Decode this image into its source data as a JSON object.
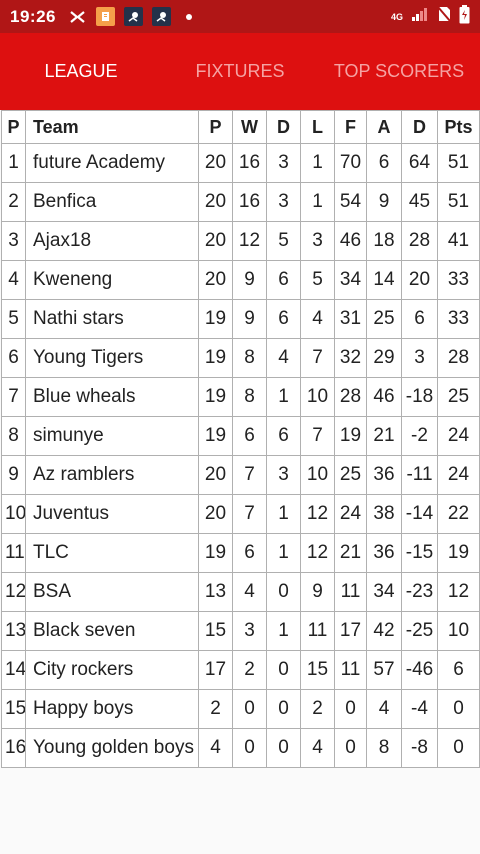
{
  "status_bar": {
    "time": "19:26",
    "network_label": "4G",
    "icons": [
      "capcut-icon",
      "app-icon",
      "football-app-icon",
      "football-app-icon",
      "notification-dot",
      "signal-icon",
      "no-sim-icon",
      "battery-icon"
    ]
  },
  "tabs": [
    {
      "label": "LEAGUE",
      "active": true
    },
    {
      "label": "FIXTURES",
      "active": false
    },
    {
      "label": "TOP SCORERS",
      "active": false
    }
  ],
  "colors": {
    "status_bar": "#b01616",
    "app_bar": "#dd1010",
    "tab_active": "#ffffff",
    "tab_inactive": "#f5a3a3"
  },
  "table": {
    "headers": [
      "P",
      "Team",
      "P",
      "W",
      "D",
      "L",
      "F",
      "A",
      "D",
      "Pts"
    ],
    "rows": [
      [
        "1",
        "future Academy",
        "20",
        "16",
        "3",
        "1",
        "70",
        "6",
        "64",
        "51"
      ],
      [
        "2",
        "Benfica",
        "20",
        "16",
        "3",
        "1",
        "54",
        "9",
        "45",
        "51"
      ],
      [
        "3",
        "Ajax18",
        "20",
        "12",
        "5",
        "3",
        "46",
        "18",
        "28",
        "41"
      ],
      [
        "4",
        "Kweneng",
        "20",
        "9",
        "6",
        "5",
        "34",
        "14",
        "20",
        "33"
      ],
      [
        "5",
        "Nathi stars",
        "19",
        "9",
        "6",
        "4",
        "31",
        "25",
        "6",
        "33"
      ],
      [
        "6",
        "Young Tigers",
        "19",
        "8",
        "4",
        "7",
        "32",
        "29",
        "3",
        "28"
      ],
      [
        "7",
        "Blue wheals",
        "19",
        "8",
        "1",
        "10",
        "28",
        "46",
        "-18",
        "25"
      ],
      [
        "8",
        "simunye",
        "19",
        "6",
        "6",
        "7",
        "19",
        "21",
        "-2",
        "24"
      ],
      [
        "9",
        "Az ramblers",
        "20",
        "7",
        "3",
        "10",
        "25",
        "36",
        "-11",
        "24"
      ],
      [
        "10",
        "Juventus",
        "20",
        "7",
        "1",
        "12",
        "24",
        "38",
        "-14",
        "22"
      ],
      [
        "11",
        "TLC",
        "19",
        "6",
        "1",
        "12",
        "21",
        "36",
        "-15",
        "19"
      ],
      [
        "12",
        "BSA",
        "13",
        "4",
        "0",
        "9",
        "11",
        "34",
        "-23",
        "12"
      ],
      [
        "13",
        "Black seven",
        "15",
        "3",
        "1",
        "11",
        "17",
        "42",
        "-25",
        "10"
      ],
      [
        "14",
        "City rockers",
        "17",
        "2",
        "0",
        "15",
        "11",
        "57",
        "-46",
        "6"
      ],
      [
        "15",
        "Happy boys",
        "2",
        "0",
        "0",
        "2",
        "0",
        "4",
        "-4",
        "0"
      ],
      [
        "16",
        "Young golden boys",
        "4",
        "0",
        "0",
        "4",
        "0",
        "8",
        "-8",
        "0"
      ]
    ]
  }
}
